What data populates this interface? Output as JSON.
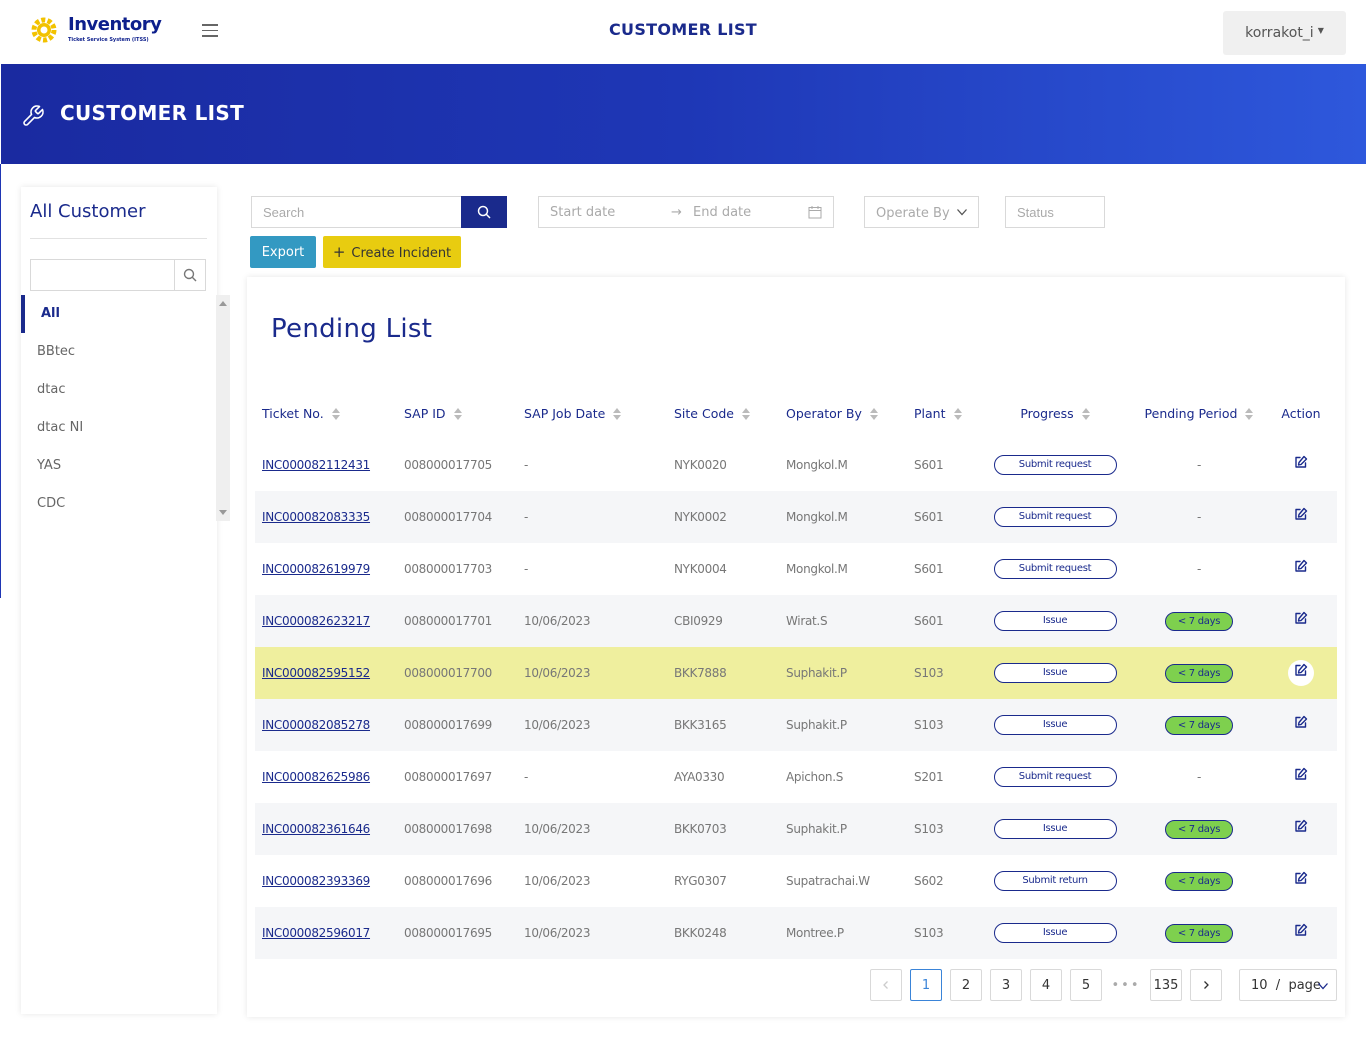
{
  "app": {
    "logo_title": "Inventory",
    "logo_subtitle": "Ticket Service System (ITSS)",
    "page_title": "CUSTOMER LIST",
    "user": "korrakot_i"
  },
  "banner": {
    "title": "CUSTOMER LIST"
  },
  "sidebar": {
    "title": "All Customer",
    "search_placeholder": "",
    "items": [
      {
        "label": "All",
        "active": true
      },
      {
        "label": "BBtec"
      },
      {
        "label": "dtac"
      },
      {
        "label": "dtac NI"
      },
      {
        "label": "YAS"
      },
      {
        "label": "CDC"
      }
    ]
  },
  "filters": {
    "search_placeholder": "Search",
    "start_date_placeholder": "Start date",
    "end_date_placeholder": "End date",
    "operate_by_placeholder": "Operate By",
    "status_placeholder": "Status"
  },
  "buttons": {
    "export": "Export",
    "create_incident": "Create Incident"
  },
  "list": {
    "title": "Pending  List",
    "columns": {
      "ticket": "Ticket No.",
      "sap_id": "SAP ID",
      "sap_job_date": "SAP Job Date",
      "site_code": "Site Code",
      "operator_by": "Operator By",
      "plant": "Plant",
      "progress": "Progress",
      "pending_period": "Pending Period",
      "action": "Action"
    },
    "rows": [
      {
        "ticket": "INC000082112431",
        "sap_id": "008000017705",
        "date": "-",
        "site": "NYK0020",
        "operator": "Mongkol.M",
        "plant": "S601",
        "progress": "Submit request",
        "pending": "-"
      },
      {
        "ticket": "INC000082083335",
        "sap_id": "008000017704",
        "date": "-",
        "site": "NYK0002",
        "operator": "Mongkol.M",
        "plant": "S601",
        "progress": "Submit request",
        "pending": "-"
      },
      {
        "ticket": "INC000082619979",
        "sap_id": "008000017703",
        "date": "-",
        "site": "NYK0004",
        "operator": "Mongkol.M",
        "plant": "S601",
        "progress": "Submit request",
        "pending": "-"
      },
      {
        "ticket": "INC000082623217",
        "sap_id": "008000017701",
        "date": "10/06/2023",
        "site": "CBI0929",
        "operator": "Wirat.S",
        "plant": "S601",
        "progress": "Issue",
        "pending": "< 7 days"
      },
      {
        "ticket": "INC000082595152",
        "sap_id": "008000017700",
        "date": "10/06/2023",
        "site": "BKK7888",
        "operator": "Suphakit.P",
        "plant": "S103",
        "progress": "Issue",
        "pending": "< 7 days",
        "highlight": true
      },
      {
        "ticket": "INC000082085278",
        "sap_id": "008000017699",
        "date": "10/06/2023",
        "site": "BKK3165",
        "operator": "Suphakit.P",
        "plant": "S103",
        "progress": "Issue",
        "pending": "< 7 days"
      },
      {
        "ticket": "INC000082625986",
        "sap_id": "008000017697",
        "date": "-",
        "site": "AYA0330",
        "operator": "Apichon.S",
        "plant": "S201",
        "progress": "Submit request",
        "pending": "-"
      },
      {
        "ticket": "INC000082361646",
        "sap_id": "008000017698",
        "date": "10/06/2023",
        "site": "BKK0703",
        "operator": "Suphakit.P",
        "plant": "S103",
        "progress": "Issue",
        "pending": "< 7 days"
      },
      {
        "ticket": "INC000082393369",
        "sap_id": "008000017696",
        "date": "10/06/2023",
        "site": "RYG0307",
        "operator": "Supatrachai.W",
        "plant": "S602",
        "progress": "Submit return",
        "pending": "< 7 days"
      },
      {
        "ticket": "INC000082596017",
        "sap_id": "008000017695",
        "date": "10/06/2023",
        "site": "BKK0248",
        "operator": "Montree.P",
        "plant": "S103",
        "progress": "Issue",
        "pending": "< 7 days"
      }
    ]
  },
  "pagination": {
    "pages": [
      "1",
      "2",
      "3",
      "4",
      "5"
    ],
    "ellipsis": "•••",
    "last": "135",
    "current": "1",
    "page_size": "10  /  page"
  },
  "colors": {
    "primary": "#1a2a8c",
    "export": "#3399c2",
    "create": "#e8cc10",
    "pending_badge": "#7ed04e",
    "highlight_row": "#efef9e"
  }
}
